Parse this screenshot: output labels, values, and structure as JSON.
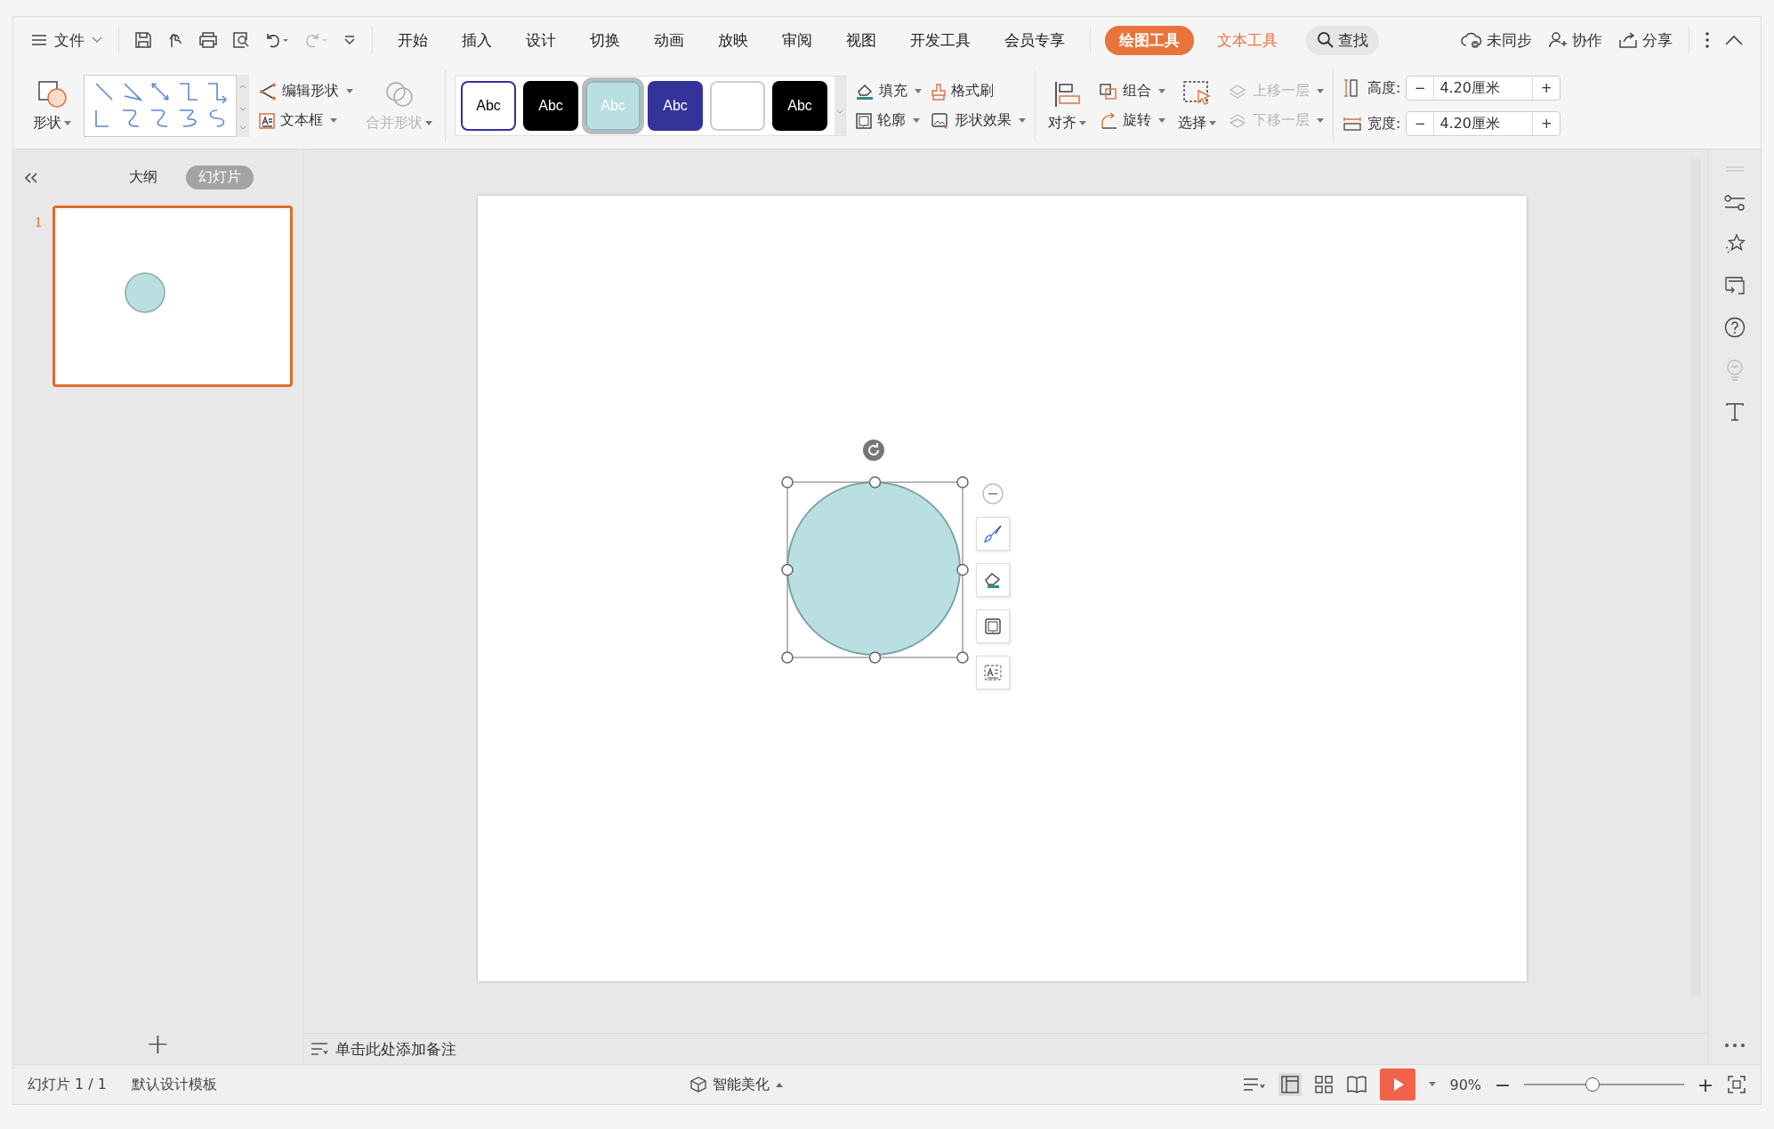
{
  "menu": {
    "label": "文件"
  },
  "tabs": [
    {
      "label": "开始",
      "selected": false,
      "contextual": false
    },
    {
      "label": "插入",
      "selected": false,
      "contextual": false
    },
    {
      "label": "设计",
      "selected": false,
      "contextual": false
    },
    {
      "label": "切换",
      "selected": false,
      "contextual": false
    },
    {
      "label": "动画",
      "selected": false,
      "contextual": false
    },
    {
      "label": "放映",
      "selected": false,
      "contextual": false
    },
    {
      "label": "审阅",
      "selected": false,
      "contextual": false
    },
    {
      "label": "视图",
      "selected": false,
      "contextual": false
    },
    {
      "label": "开发工具",
      "selected": false,
      "contextual": false
    },
    {
      "label": "会员专享",
      "selected": false,
      "contextual": false
    },
    {
      "label": "绘图工具",
      "selected": true,
      "contextual": true
    },
    {
      "label": "文本工具",
      "selected": false,
      "contextual": true
    }
  ],
  "search": {
    "label": "查找"
  },
  "top_actions": [
    {
      "label": "未同步",
      "kind": "cloud"
    },
    {
      "label": "协作",
      "kind": "people"
    },
    {
      "label": "分享",
      "kind": "share"
    }
  ],
  "ribbon": {
    "shape": {
      "label": "形状"
    },
    "edit_shape": {
      "label": "编辑形状"
    },
    "text_box": {
      "label": "文本框"
    },
    "merge_shapes": {
      "label": "合并形状",
      "disabled": true
    },
    "styles": [
      {
        "label": "Abc",
        "color": "#ffffff",
        "kind": "outlined",
        "selected": false
      },
      {
        "label": "Abc",
        "color": "#000000",
        "kind": "filled",
        "selected": false
      },
      {
        "label": "Abc",
        "color": "#b9dfe2",
        "kind": "filled",
        "selected": true
      },
      {
        "label": "Abc",
        "color": "#343399",
        "kind": "filled",
        "selected": false
      },
      {
        "color": "#ffffff",
        "kind": "blank",
        "selected": false
      },
      {
        "label": "Abc",
        "color": "#000000",
        "kind": "filled",
        "selected": false
      }
    ],
    "fill": {
      "label": "填充"
    },
    "format_painter": {
      "label": "格式刷"
    },
    "outline": {
      "label": "轮廓"
    },
    "shape_effects": {
      "label": "形状效果"
    },
    "align": {
      "label": "对齐"
    },
    "group": {
      "label": "组合"
    },
    "rotate": {
      "label": "旋转"
    },
    "select": {
      "label": "选择"
    },
    "bring_forward": {
      "label": "上移一层",
      "disabled": true
    },
    "send_backward": {
      "label": "下移一层",
      "disabled": true
    },
    "size_fields": [
      {
        "label": "高度:",
        "value": "4.20厘米",
        "kind": "height",
        "minus": "−",
        "plus": "+"
      },
      {
        "label": "宽度:",
        "value": "4.20厘米",
        "kind": "width",
        "minus": "−",
        "plus": "+"
      }
    ]
  },
  "panel": {
    "tabs": [
      {
        "label": "大纲",
        "selected": false
      },
      {
        "label": "幻灯片",
        "selected": true
      }
    ],
    "slides": [
      {
        "number": "1",
        "selected": true
      }
    ],
    "add": "+"
  },
  "notes": {
    "label": "单击此处添加备注"
  },
  "status_bar": {
    "slide": "幻灯片 1 / 1",
    "template": "默认设计模板",
    "beautify": "智能美化",
    "zoom": "90%",
    "zoom_minus": "−",
    "zoom_plus": "+",
    "level": 0.43
  }
}
